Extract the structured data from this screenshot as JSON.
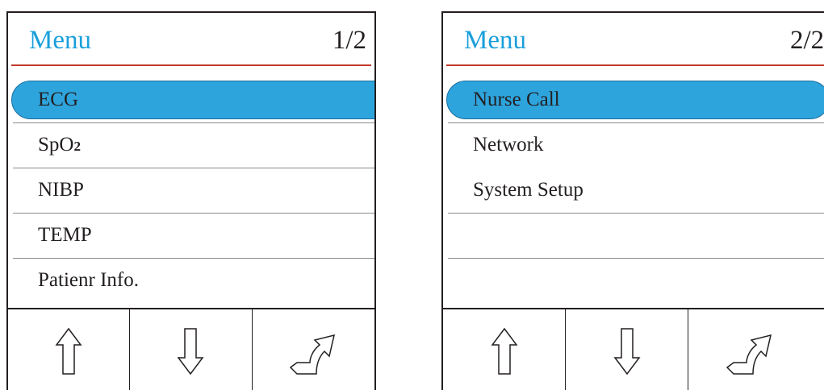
{
  "panels": [
    {
      "title": "Menu",
      "page": "1/2",
      "items": [
        {
          "label": "ECG",
          "selected": true
        },
        {
          "label": "SpO",
          "sub": "2",
          "selected": false
        },
        {
          "label": "NIBP",
          "selected": false
        },
        {
          "label": "TEMP",
          "selected": false
        },
        {
          "label": "Patienr Info.",
          "selected": false
        }
      ],
      "footer_buttons": [
        "up-arrow-icon",
        "down-arrow-icon",
        "back-arrow-icon"
      ]
    },
    {
      "title": "Menu",
      "page": "2/2",
      "items": [
        {
          "label": "Nurse Call",
          "selected": true
        },
        {
          "label": "Network",
          "selected": false
        },
        {
          "label": "System Setup",
          "selected": false
        },
        {
          "label": "",
          "selected": false
        },
        {
          "label": "",
          "selected": false
        }
      ],
      "footer_buttons": [
        "up-arrow-icon",
        "down-arrow-icon",
        "back-arrow-icon"
      ]
    }
  ],
  "colors": {
    "title": "#1a9fdb",
    "highlight": "#2ea4dd",
    "header_rule": "#c0392b",
    "text": "#231f20"
  }
}
